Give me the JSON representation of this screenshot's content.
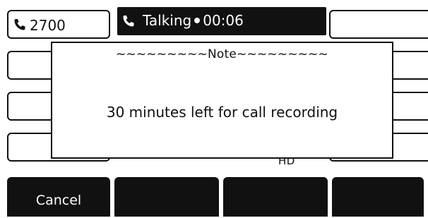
{
  "line_keys": {
    "left": [
      {
        "label": "2700",
        "icon": "phone-icon"
      },
      {
        "label": ""
      },
      {
        "label": ""
      },
      {
        "label": ""
      }
    ],
    "right": [
      {
        "label": ""
      },
      {
        "label": ""
      },
      {
        "label": ""
      },
      {
        "label": ""
      }
    ]
  },
  "status": {
    "state": "Talking",
    "timer": "00:06",
    "icon": "phone-icon",
    "hd_badge": "HD"
  },
  "dialog": {
    "title": "~~~~~~~~~Note~~~~~~~~~",
    "message": "30 minutes left for call recording"
  },
  "softkeys": [
    {
      "label": "Cancel"
    },
    {
      "label": ""
    },
    {
      "label": ""
    },
    {
      "label": ""
    }
  ],
  "colors": {
    "foreground": "#111111",
    "background": "#ffffff"
  }
}
